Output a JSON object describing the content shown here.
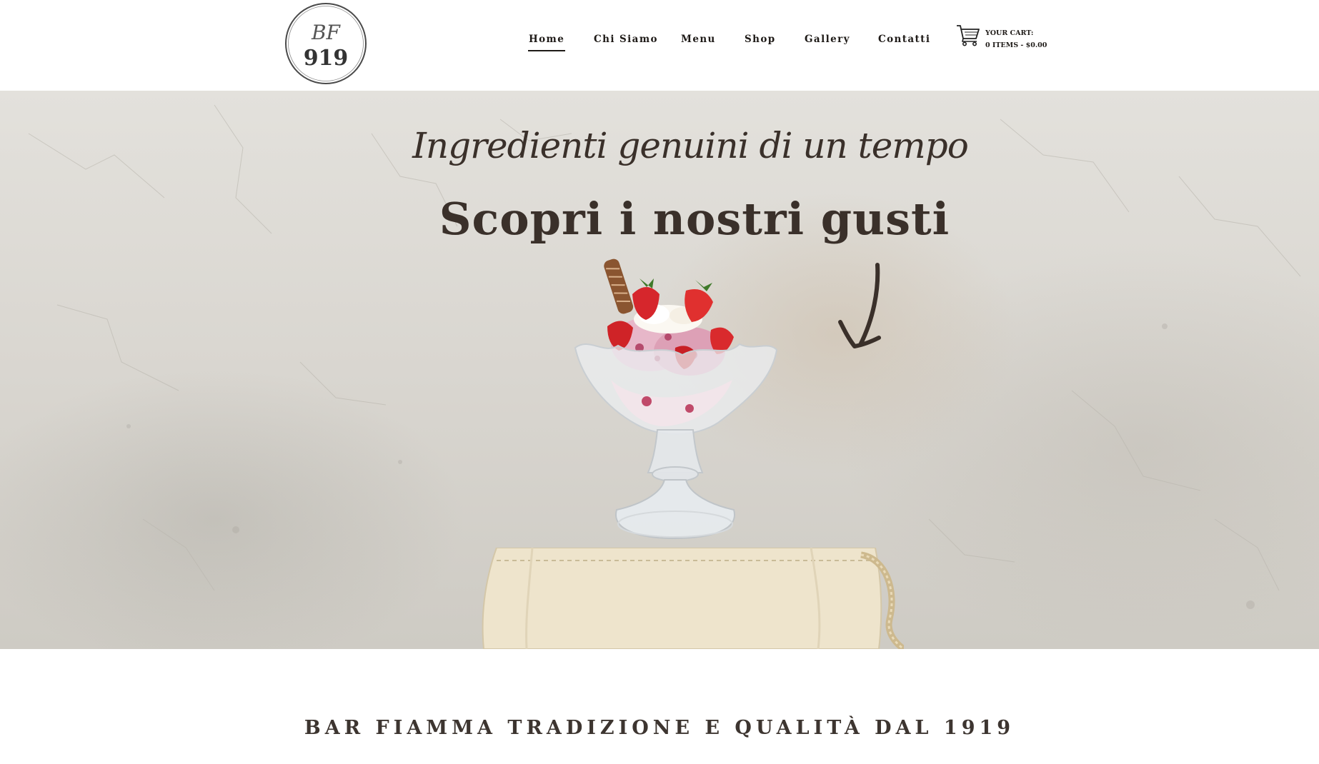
{
  "header": {
    "logo": {
      "monogram": "BF",
      "year": "919"
    },
    "nav": [
      {
        "label": "Home",
        "active": true
      },
      {
        "label": "Chi Siamo",
        "active": false
      },
      {
        "label": "Menu",
        "active": false
      },
      {
        "label": "Shop",
        "active": false
      },
      {
        "label": "Gallery",
        "active": false
      },
      {
        "label": "Contatti",
        "active": false
      }
    ],
    "cart": {
      "icon": "cart-icon",
      "title": "YOUR CART:",
      "summary": "0 ITEMS - $0.00"
    }
  },
  "hero": {
    "tagline": "Ingredienti genuini di un tempo",
    "title": "Scopri i nostri gusti",
    "arrow_icon": "hand-drawn-arrow-icon"
  },
  "tradition": {
    "text": "BAR FIAMMA TRADIZIONE E QUALITÀ DAL 1919"
  },
  "colors": {
    "text_dark": "#3a302a",
    "nav_text": "#1e1a17",
    "hero_bg": "#dcd9d3"
  }
}
